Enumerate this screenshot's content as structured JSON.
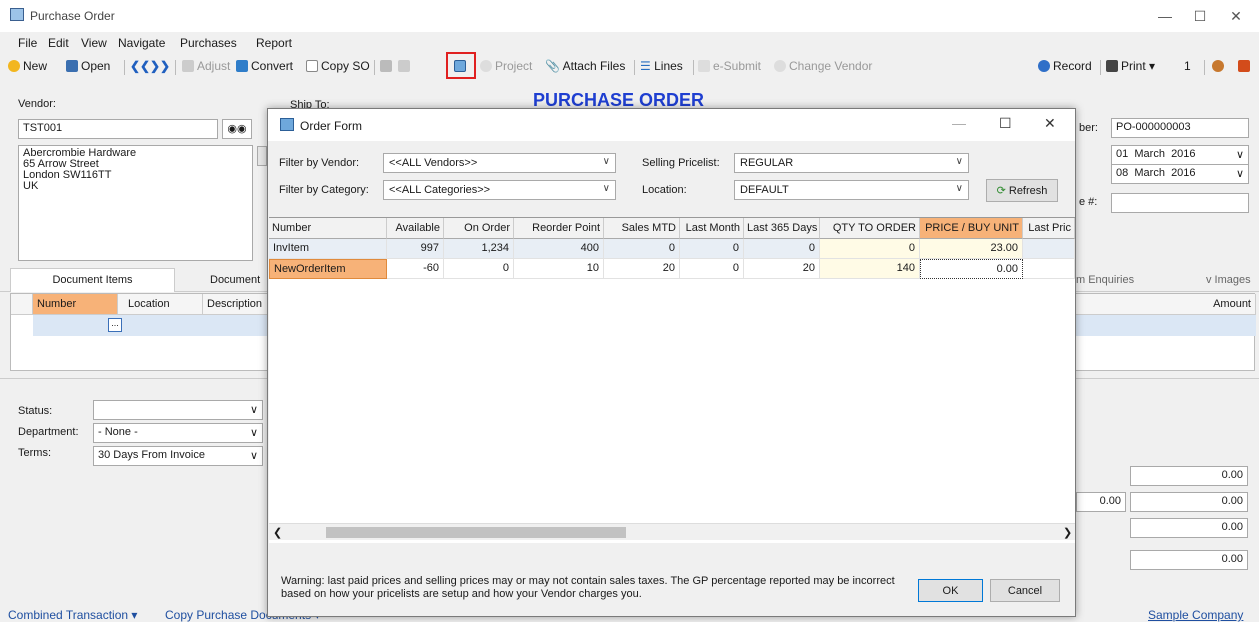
{
  "window": {
    "title": "Purchase Order"
  },
  "menu": [
    "File",
    "Edit",
    "View",
    "Navigate",
    "Purchases",
    "Report"
  ],
  "toolbar": {
    "new": "New",
    "open": "Open",
    "adjust": "Adjust",
    "convert": "Convert",
    "copy_so": "Copy SO",
    "project": "Project",
    "attach": "Attach Files",
    "lines": "Lines",
    "esubmit": "e-Submit",
    "change_vendor": "Change Vendor",
    "record": "Record",
    "print": "Print",
    "print_copies": "1"
  },
  "heading": "PURCHASE ORDER",
  "vendor": {
    "label": "Vendor:",
    "code": "TST001",
    "address": [
      "Abercrombie Hardware",
      "65 Arrow Street",
      "London  SW116TT",
      "UK"
    ]
  },
  "ship_to": {
    "label": "Ship To:"
  },
  "right_fields": {
    "number_label": "ber:",
    "number": "PO-000000003",
    "date1": {
      "day": "01",
      "month": "March",
      "year": "2016"
    },
    "date2": {
      "day": "08",
      "month": "March",
      "year": "2016"
    },
    "ref_label": "e #:"
  },
  "tabs": [
    "Document Items",
    "Document",
    "m Enquiries",
    "v Images"
  ],
  "items_grid": {
    "columns": [
      "Number",
      "Location",
      "Description"
    ],
    "amount_label": "Amount"
  },
  "bottom": {
    "status_label": "Status:",
    "department_label": "Department:",
    "department": "- None -",
    "terms_label": "Terms:",
    "terms": "30 Days From Invoice",
    "totals": [
      "0.00",
      "0.00",
      "0.00",
      "0.00"
    ],
    "extra_total": "0.00"
  },
  "footer": {
    "combined": "Combined Transaction",
    "copy_docs": "Copy Purchase Documents",
    "company": "Sample Company"
  },
  "dialog": {
    "title": "Order Form",
    "filter_vendor_label": "Filter by Vendor:",
    "filter_vendor": "<<ALL Vendors>>",
    "filter_category_label": "Filter by Category:",
    "filter_category": "<<ALL Categories>>",
    "pricelist_label": "Selling Pricelist:",
    "pricelist": "REGULAR",
    "location_label": "Location:",
    "location": "DEFAULT",
    "refresh": "Refresh",
    "columns": [
      "Number",
      "Available",
      "On Order",
      "Reorder Point",
      "Sales MTD",
      "Last Month",
      "Last 365 Days",
      "QTY TO ORDER",
      "PRICE / BUY UNIT",
      "Last Pric"
    ],
    "rows": [
      [
        "InvItem",
        "997",
        "1,234",
        "400",
        "0",
        "0",
        "0",
        "0",
        "23.00",
        ""
      ],
      [
        "NewOrderItem",
        "-60",
        "0",
        "10",
        "20",
        "0",
        "20",
        "140",
        "0.00",
        ""
      ]
    ],
    "warning": "Warning: last paid prices and selling prices may or may not contain sales taxes. The GP percentage reported may be incorrect based on how your pricelists are setup and how your Vendor charges you.",
    "ok": "OK",
    "cancel": "Cancel"
  }
}
